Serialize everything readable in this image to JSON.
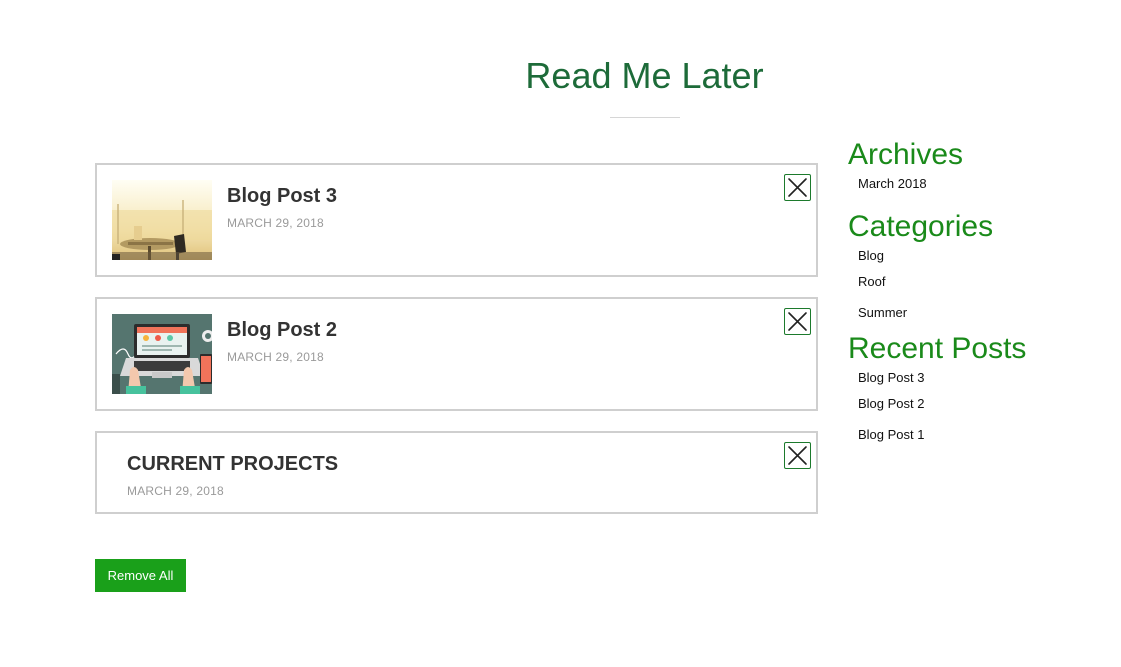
{
  "page": {
    "title": "Read Me Later"
  },
  "posts": [
    {
      "title": "Blog Post 3",
      "date": "MARCH 29, 2018",
      "thumbnail": "office-desk-photo"
    },
    {
      "title": "Blog Post 2",
      "date": "MARCH 29, 2018",
      "thumbnail": "laptop-illustration"
    },
    {
      "title": "CURRENT PROJECTS",
      "date": "MARCH 29, 2018",
      "thumbnail": ""
    }
  ],
  "actions": {
    "remove_all_label": "Remove All"
  },
  "sidebar": {
    "archives": {
      "title": "Archives",
      "items": [
        "March 2018"
      ]
    },
    "categories": {
      "title": "Categories",
      "items": [
        "Blog",
        "Roof",
        "Summer"
      ]
    },
    "recent_posts": {
      "title": "Recent Posts",
      "items": [
        "Blog Post 3",
        "Blog Post 2",
        "Blog Post 1"
      ]
    }
  },
  "colors": {
    "title": "#1d6b39",
    "widget_title": "#1a8a1a",
    "button": "#1aa01a",
    "border": "#cfcfcf"
  },
  "icons": {
    "remove_post": "close-x-icon"
  }
}
